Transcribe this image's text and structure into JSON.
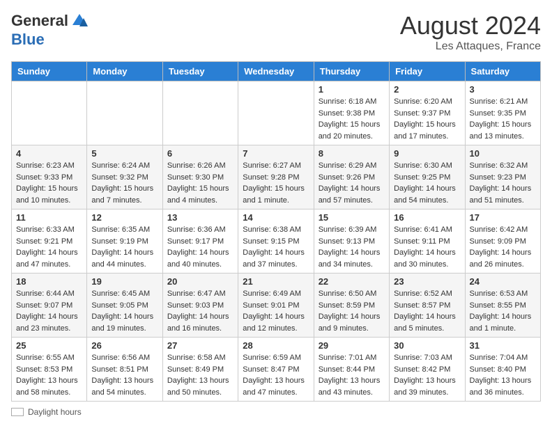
{
  "header": {
    "logo_general": "General",
    "logo_blue": "Blue",
    "month_year": "August 2024",
    "location": "Les Attaques, France"
  },
  "days_of_week": [
    "Sunday",
    "Monday",
    "Tuesday",
    "Wednesday",
    "Thursday",
    "Friday",
    "Saturday"
  ],
  "weeks": [
    [
      {
        "day": "",
        "sunrise": "",
        "sunset": "",
        "daylight": ""
      },
      {
        "day": "",
        "sunrise": "",
        "sunset": "",
        "daylight": ""
      },
      {
        "day": "",
        "sunrise": "",
        "sunset": "",
        "daylight": ""
      },
      {
        "day": "",
        "sunrise": "",
        "sunset": "",
        "daylight": ""
      },
      {
        "day": "1",
        "sunrise": "6:18 AM",
        "sunset": "9:38 PM",
        "daylight": "15 hours and 20 minutes."
      },
      {
        "day": "2",
        "sunrise": "6:20 AM",
        "sunset": "9:37 PM",
        "daylight": "15 hours and 17 minutes."
      },
      {
        "day": "3",
        "sunrise": "6:21 AM",
        "sunset": "9:35 PM",
        "daylight": "15 hours and 13 minutes."
      }
    ],
    [
      {
        "day": "4",
        "sunrise": "6:23 AM",
        "sunset": "9:33 PM",
        "daylight": "15 hours and 10 minutes."
      },
      {
        "day": "5",
        "sunrise": "6:24 AM",
        "sunset": "9:32 PM",
        "daylight": "15 hours and 7 minutes."
      },
      {
        "day": "6",
        "sunrise": "6:26 AM",
        "sunset": "9:30 PM",
        "daylight": "15 hours and 4 minutes."
      },
      {
        "day": "7",
        "sunrise": "6:27 AM",
        "sunset": "9:28 PM",
        "daylight": "15 hours and 1 minute."
      },
      {
        "day": "8",
        "sunrise": "6:29 AM",
        "sunset": "9:26 PM",
        "daylight": "14 hours and 57 minutes."
      },
      {
        "day": "9",
        "sunrise": "6:30 AM",
        "sunset": "9:25 PM",
        "daylight": "14 hours and 54 minutes."
      },
      {
        "day": "10",
        "sunrise": "6:32 AM",
        "sunset": "9:23 PM",
        "daylight": "14 hours and 51 minutes."
      }
    ],
    [
      {
        "day": "11",
        "sunrise": "6:33 AM",
        "sunset": "9:21 PM",
        "daylight": "14 hours and 47 minutes."
      },
      {
        "day": "12",
        "sunrise": "6:35 AM",
        "sunset": "9:19 PM",
        "daylight": "14 hours and 44 minutes."
      },
      {
        "day": "13",
        "sunrise": "6:36 AM",
        "sunset": "9:17 PM",
        "daylight": "14 hours and 40 minutes."
      },
      {
        "day": "14",
        "sunrise": "6:38 AM",
        "sunset": "9:15 PM",
        "daylight": "14 hours and 37 minutes."
      },
      {
        "day": "15",
        "sunrise": "6:39 AM",
        "sunset": "9:13 PM",
        "daylight": "14 hours and 34 minutes."
      },
      {
        "day": "16",
        "sunrise": "6:41 AM",
        "sunset": "9:11 PM",
        "daylight": "14 hours and 30 minutes."
      },
      {
        "day": "17",
        "sunrise": "6:42 AM",
        "sunset": "9:09 PM",
        "daylight": "14 hours and 26 minutes."
      }
    ],
    [
      {
        "day": "18",
        "sunrise": "6:44 AM",
        "sunset": "9:07 PM",
        "daylight": "14 hours and 23 minutes."
      },
      {
        "day": "19",
        "sunrise": "6:45 AM",
        "sunset": "9:05 PM",
        "daylight": "14 hours and 19 minutes."
      },
      {
        "day": "20",
        "sunrise": "6:47 AM",
        "sunset": "9:03 PM",
        "daylight": "14 hours and 16 minutes."
      },
      {
        "day": "21",
        "sunrise": "6:49 AM",
        "sunset": "9:01 PM",
        "daylight": "14 hours and 12 minutes."
      },
      {
        "day": "22",
        "sunrise": "6:50 AM",
        "sunset": "8:59 PM",
        "daylight": "14 hours and 9 minutes."
      },
      {
        "day": "23",
        "sunrise": "6:52 AM",
        "sunset": "8:57 PM",
        "daylight": "14 hours and 5 minutes."
      },
      {
        "day": "24",
        "sunrise": "6:53 AM",
        "sunset": "8:55 PM",
        "daylight": "14 hours and 1 minute."
      }
    ],
    [
      {
        "day": "25",
        "sunrise": "6:55 AM",
        "sunset": "8:53 PM",
        "daylight": "13 hours and 58 minutes."
      },
      {
        "day": "26",
        "sunrise": "6:56 AM",
        "sunset": "8:51 PM",
        "daylight": "13 hours and 54 minutes."
      },
      {
        "day": "27",
        "sunrise": "6:58 AM",
        "sunset": "8:49 PM",
        "daylight": "13 hours and 50 minutes."
      },
      {
        "day": "28",
        "sunrise": "6:59 AM",
        "sunset": "8:47 PM",
        "daylight": "13 hours and 47 minutes."
      },
      {
        "day": "29",
        "sunrise": "7:01 AM",
        "sunset": "8:44 PM",
        "daylight": "13 hours and 43 minutes."
      },
      {
        "day": "30",
        "sunrise": "7:03 AM",
        "sunset": "8:42 PM",
        "daylight": "13 hours and 39 minutes."
      },
      {
        "day": "31",
        "sunrise": "7:04 AM",
        "sunset": "8:40 PM",
        "daylight": "13 hours and 36 minutes."
      }
    ]
  ],
  "footer": {
    "daylight_label": "Daylight hours"
  },
  "labels": {
    "sunrise_prefix": "Sunrise: ",
    "sunset_prefix": "Sunset: ",
    "daylight_prefix": "Daylight: "
  }
}
